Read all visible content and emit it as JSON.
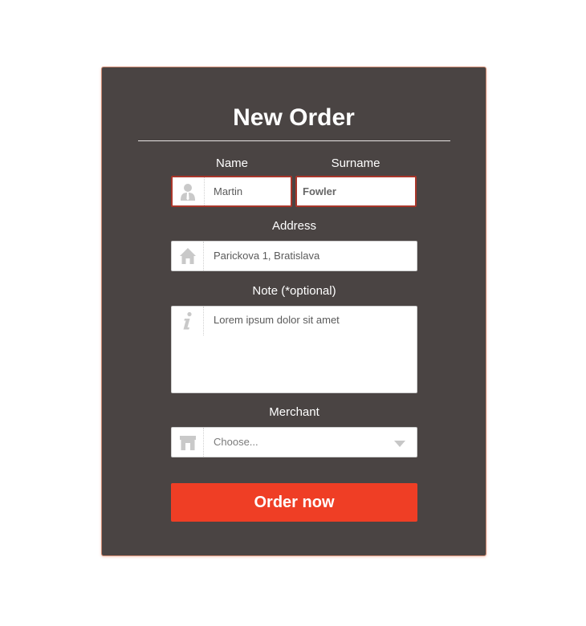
{
  "form": {
    "title": "New Order",
    "name": {
      "label": "Name",
      "value": "Martin",
      "icon": "person-icon"
    },
    "surname": {
      "label": "Surname",
      "value": "Fowler"
    },
    "address": {
      "label": "Address",
      "value": "Parickova 1, Bratislava",
      "icon": "home-icon"
    },
    "note": {
      "label": "Note (*optional)",
      "value": "Lorem ipsum dolor sit amet",
      "icon": "info-icon"
    },
    "merchant": {
      "label": "Merchant",
      "placeholder": "Choose...",
      "icon": "store-icon"
    },
    "submit_label": "Order now"
  },
  "colors": {
    "card_background": "#4a4443",
    "accent": "#ef3e25",
    "error_border": "#a9362a"
  }
}
